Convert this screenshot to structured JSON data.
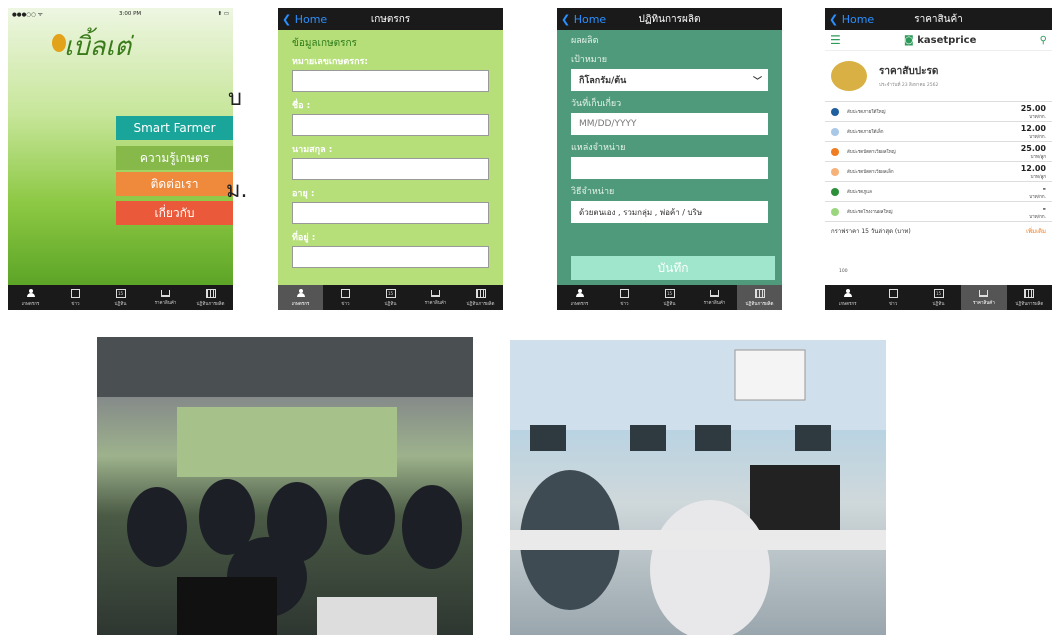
{
  "tabs": [
    "เกษตรกร",
    "ข่าว",
    "ปฏิทิน",
    "ราคาสินค้า",
    "ปฏิทินการผลิต"
  ],
  "calendar_day": "15",
  "screen1": {
    "status_left": "●●●○○ ᯤ",
    "time": "3:00 PM",
    "status_right": "⬆ ▭",
    "logo_text": "เบิ้ลเต่",
    "menu": [
      "Smart Farmer",
      "ความรู้เกษตร",
      "ติดต่อเรา",
      "เกี่ยวกับ"
    ],
    "colors": {
      "smart_farmer": "#1aa59a",
      "knowledge": "#86b94a",
      "contact": "#ef8a3c",
      "about": "#ea5a3a"
    }
  },
  "overlay_chars": {
    "char1": "บ",
    "char2": "ม."
  },
  "screen2": {
    "back": "Home",
    "title": "เกษตรกร",
    "heading": "ข้อมูลเกษตรกร",
    "fields": [
      "หมายเลขเกษตรกร:",
      "ชื่อ :",
      "นามสกุล :",
      "อายุ :",
      "ที่อยู่ :"
    ]
  },
  "screen3": {
    "back": "Home",
    "title": "ปฏิทินการผลิต",
    "top_label": "ผลผลิต",
    "target_label": "เป้าหมาย",
    "unit_value": "กิโลกรัม/ต้น",
    "harvest_label": "วันที่เก็บเกี่ยว",
    "date_placeholder": "MM/DD/YYYY",
    "source_label": "แหล่งจำหน่าย",
    "method_label": "วิธีจำหน่าย",
    "method_value": "ด้วยตนเอง , รวมกลุ่ม , พ่อค้า / บริษ",
    "save": "บันทึก"
  },
  "screen4": {
    "back": "Home",
    "title": "ราคาสินค้า",
    "brand": "kasetprice",
    "heading": "ราคาสับปะรด",
    "date": "ประจำวันที่ 23 สิงหาคม 2562",
    "rows": [
      {
        "name": "สับปะรดภายใต้ใหญ่",
        "value": "25.00",
        "unit": "บาท/กก.",
        "color": "#1f5f9e"
      },
      {
        "name": "สับปะรดภายใต้เล็ก",
        "value": "12.00",
        "unit": "บาท/กก.",
        "color": "#a9c7e6"
      },
      {
        "name": "สับปะรดปัตตาเวียผลใหญ่",
        "value": "25.00",
        "unit": "บาท/ลูก",
        "color": "#ef7d22"
      },
      {
        "name": "สับปะรดปัตตาเวียผลเล็ก",
        "value": "12.00",
        "unit": "บาท/ลูก",
        "color": "#f5b27a"
      },
      {
        "name": "สับปะรดภูแล",
        "value": "-",
        "unit": "บาท/กก.",
        "color": "#2e8f3a"
      },
      {
        "name": "สับปะรดโรงงานผลใหญ่",
        "value": "-",
        "unit": "บาท/กก.",
        "color": "#9bd67e"
      }
    ],
    "graph_label": "กราฟราคา 15 วันล่าสุด (บาท)",
    "graph_link": "เพิ่มเติม",
    "axis_tick": "100"
  }
}
